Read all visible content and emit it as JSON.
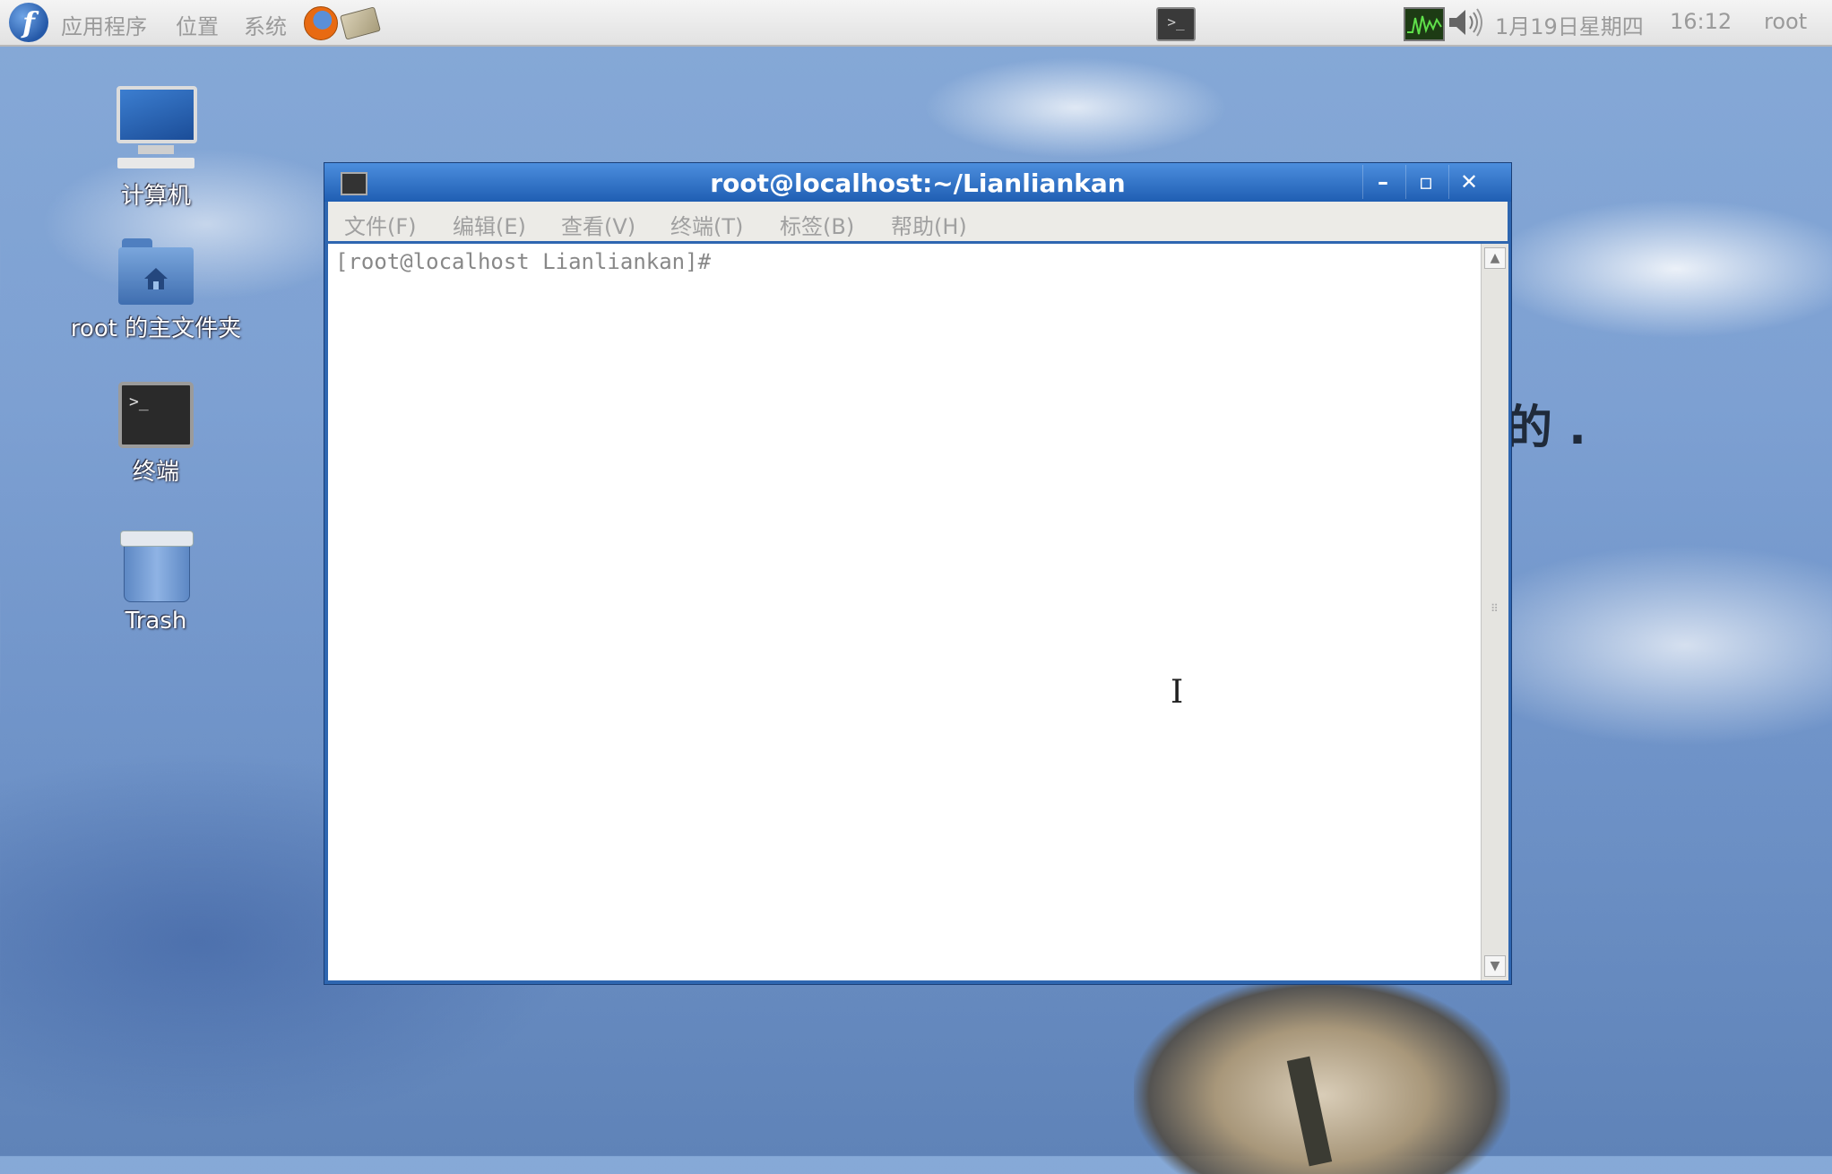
{
  "panel": {
    "menus": [
      "应用程序",
      "位置",
      "系统"
    ],
    "datetime": "1月19日星期四",
    "time": "16:12",
    "user": "root"
  },
  "desktop": {
    "icons": [
      {
        "label": "计算机",
        "icon": "computer-icon"
      },
      {
        "label": "root 的主文件夹",
        "icon": "home-folder-icon"
      },
      {
        "label": "终端",
        "icon": "terminal-icon"
      },
      {
        "label": "Trash",
        "icon": "trash-icon"
      }
    ],
    "wallpaper_text": "的 ."
  },
  "window": {
    "title": "root@localhost:~/Lianliankan",
    "menu": [
      "文件(F)",
      "编辑(E)",
      "查看(V)",
      "终端(T)",
      "标签(B)",
      "帮助(H)"
    ],
    "prompt": "[root@localhost Lianliankan]#"
  },
  "colors": {
    "titlebar": "#2e66b0",
    "panel": "#e8e8e8"
  }
}
